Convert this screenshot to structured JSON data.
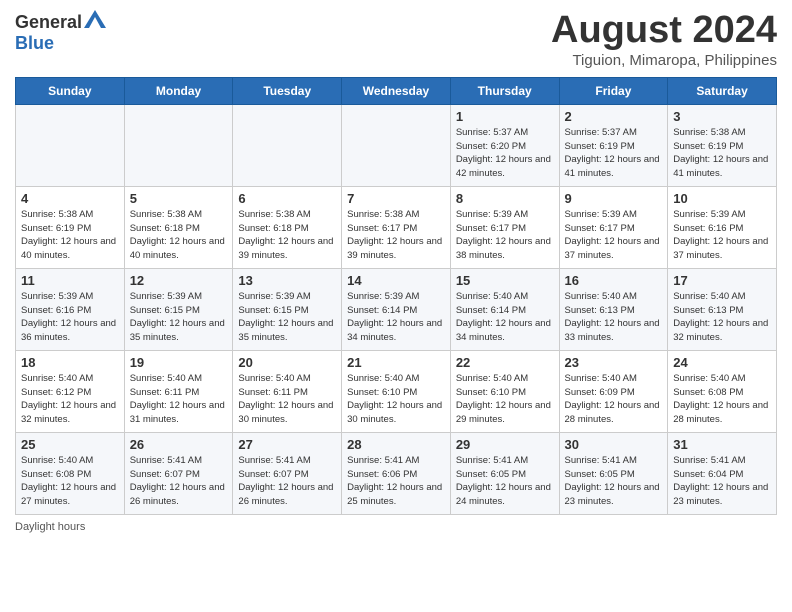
{
  "header": {
    "logo_general": "General",
    "logo_blue": "Blue",
    "month_title": "August 2024",
    "location": "Tiguion, Mimaropa, Philippines"
  },
  "days_of_week": [
    "Sunday",
    "Monday",
    "Tuesday",
    "Wednesday",
    "Thursday",
    "Friday",
    "Saturday"
  ],
  "weeks": [
    [
      {
        "day": "",
        "info": ""
      },
      {
        "day": "",
        "info": ""
      },
      {
        "day": "",
        "info": ""
      },
      {
        "day": "",
        "info": ""
      },
      {
        "day": "1",
        "info": "Sunrise: 5:37 AM\nSunset: 6:20 PM\nDaylight: 12 hours and 42 minutes."
      },
      {
        "day": "2",
        "info": "Sunrise: 5:37 AM\nSunset: 6:19 PM\nDaylight: 12 hours and 41 minutes."
      },
      {
        "day": "3",
        "info": "Sunrise: 5:38 AM\nSunset: 6:19 PM\nDaylight: 12 hours and 41 minutes."
      }
    ],
    [
      {
        "day": "4",
        "info": "Sunrise: 5:38 AM\nSunset: 6:19 PM\nDaylight: 12 hours and 40 minutes."
      },
      {
        "day": "5",
        "info": "Sunrise: 5:38 AM\nSunset: 6:18 PM\nDaylight: 12 hours and 40 minutes."
      },
      {
        "day": "6",
        "info": "Sunrise: 5:38 AM\nSunset: 6:18 PM\nDaylight: 12 hours and 39 minutes."
      },
      {
        "day": "7",
        "info": "Sunrise: 5:38 AM\nSunset: 6:17 PM\nDaylight: 12 hours and 39 minutes."
      },
      {
        "day": "8",
        "info": "Sunrise: 5:39 AM\nSunset: 6:17 PM\nDaylight: 12 hours and 38 minutes."
      },
      {
        "day": "9",
        "info": "Sunrise: 5:39 AM\nSunset: 6:17 PM\nDaylight: 12 hours and 37 minutes."
      },
      {
        "day": "10",
        "info": "Sunrise: 5:39 AM\nSunset: 6:16 PM\nDaylight: 12 hours and 37 minutes."
      }
    ],
    [
      {
        "day": "11",
        "info": "Sunrise: 5:39 AM\nSunset: 6:16 PM\nDaylight: 12 hours and 36 minutes."
      },
      {
        "day": "12",
        "info": "Sunrise: 5:39 AM\nSunset: 6:15 PM\nDaylight: 12 hours and 35 minutes."
      },
      {
        "day": "13",
        "info": "Sunrise: 5:39 AM\nSunset: 6:15 PM\nDaylight: 12 hours and 35 minutes."
      },
      {
        "day": "14",
        "info": "Sunrise: 5:39 AM\nSunset: 6:14 PM\nDaylight: 12 hours and 34 minutes."
      },
      {
        "day": "15",
        "info": "Sunrise: 5:40 AM\nSunset: 6:14 PM\nDaylight: 12 hours and 34 minutes."
      },
      {
        "day": "16",
        "info": "Sunrise: 5:40 AM\nSunset: 6:13 PM\nDaylight: 12 hours and 33 minutes."
      },
      {
        "day": "17",
        "info": "Sunrise: 5:40 AM\nSunset: 6:13 PM\nDaylight: 12 hours and 32 minutes."
      }
    ],
    [
      {
        "day": "18",
        "info": "Sunrise: 5:40 AM\nSunset: 6:12 PM\nDaylight: 12 hours and 32 minutes."
      },
      {
        "day": "19",
        "info": "Sunrise: 5:40 AM\nSunset: 6:11 PM\nDaylight: 12 hours and 31 minutes."
      },
      {
        "day": "20",
        "info": "Sunrise: 5:40 AM\nSunset: 6:11 PM\nDaylight: 12 hours and 30 minutes."
      },
      {
        "day": "21",
        "info": "Sunrise: 5:40 AM\nSunset: 6:10 PM\nDaylight: 12 hours and 30 minutes."
      },
      {
        "day": "22",
        "info": "Sunrise: 5:40 AM\nSunset: 6:10 PM\nDaylight: 12 hours and 29 minutes."
      },
      {
        "day": "23",
        "info": "Sunrise: 5:40 AM\nSunset: 6:09 PM\nDaylight: 12 hours and 28 minutes."
      },
      {
        "day": "24",
        "info": "Sunrise: 5:40 AM\nSunset: 6:08 PM\nDaylight: 12 hours and 28 minutes."
      }
    ],
    [
      {
        "day": "25",
        "info": "Sunrise: 5:40 AM\nSunset: 6:08 PM\nDaylight: 12 hours and 27 minutes."
      },
      {
        "day": "26",
        "info": "Sunrise: 5:41 AM\nSunset: 6:07 PM\nDaylight: 12 hours and 26 minutes."
      },
      {
        "day": "27",
        "info": "Sunrise: 5:41 AM\nSunset: 6:07 PM\nDaylight: 12 hours and 26 minutes."
      },
      {
        "day": "28",
        "info": "Sunrise: 5:41 AM\nSunset: 6:06 PM\nDaylight: 12 hours and 25 minutes."
      },
      {
        "day": "29",
        "info": "Sunrise: 5:41 AM\nSunset: 6:05 PM\nDaylight: 12 hours and 24 minutes."
      },
      {
        "day": "30",
        "info": "Sunrise: 5:41 AM\nSunset: 6:05 PM\nDaylight: 12 hours and 23 minutes."
      },
      {
        "day": "31",
        "info": "Sunrise: 5:41 AM\nSunset: 6:04 PM\nDaylight: 12 hours and 23 minutes."
      }
    ]
  ],
  "footer": {
    "daylight_label": "Daylight hours"
  }
}
